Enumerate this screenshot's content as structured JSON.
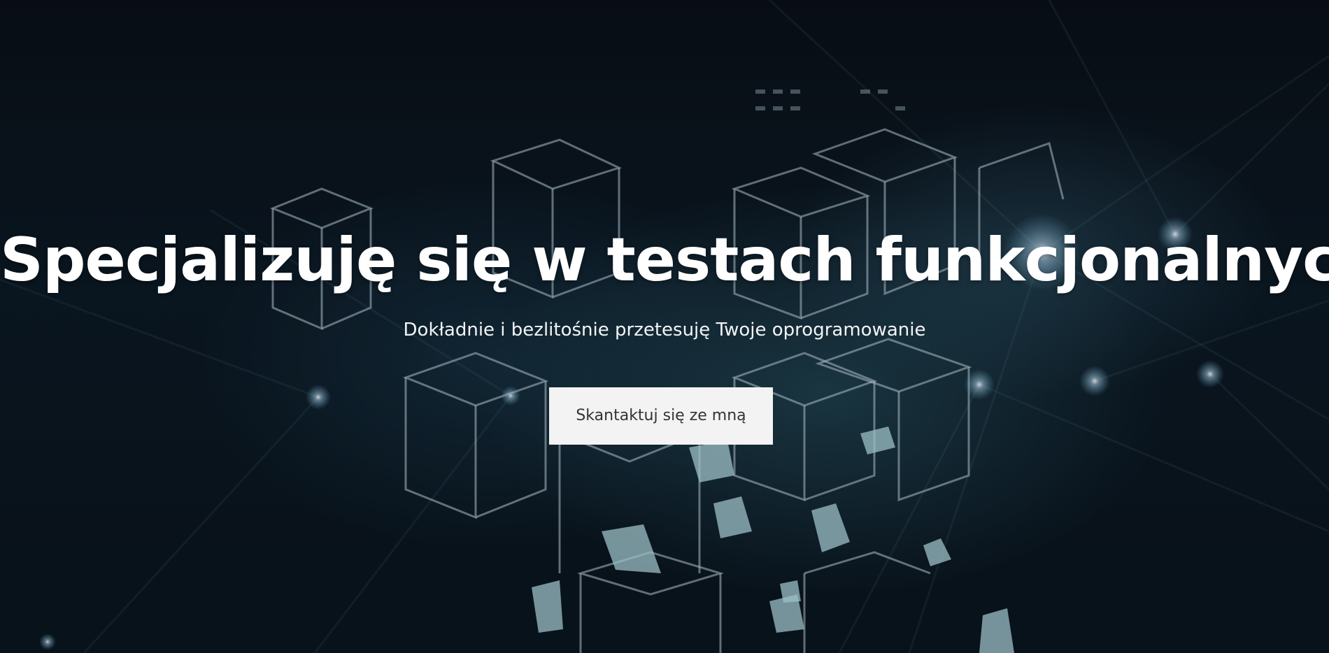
{
  "hero": {
    "title": "Specjalizuję się w testach funkcjonalnych",
    "subtitle": "Dokładnie i bezlitośnie przetesuję Twoje oprogramowanie",
    "cta_label": "Skantaktuj się ze mną"
  },
  "colors": {
    "background": "#0b1520",
    "title": "#ffffff",
    "button_bg": "#f4f3f3",
    "button_text": "#333333"
  }
}
